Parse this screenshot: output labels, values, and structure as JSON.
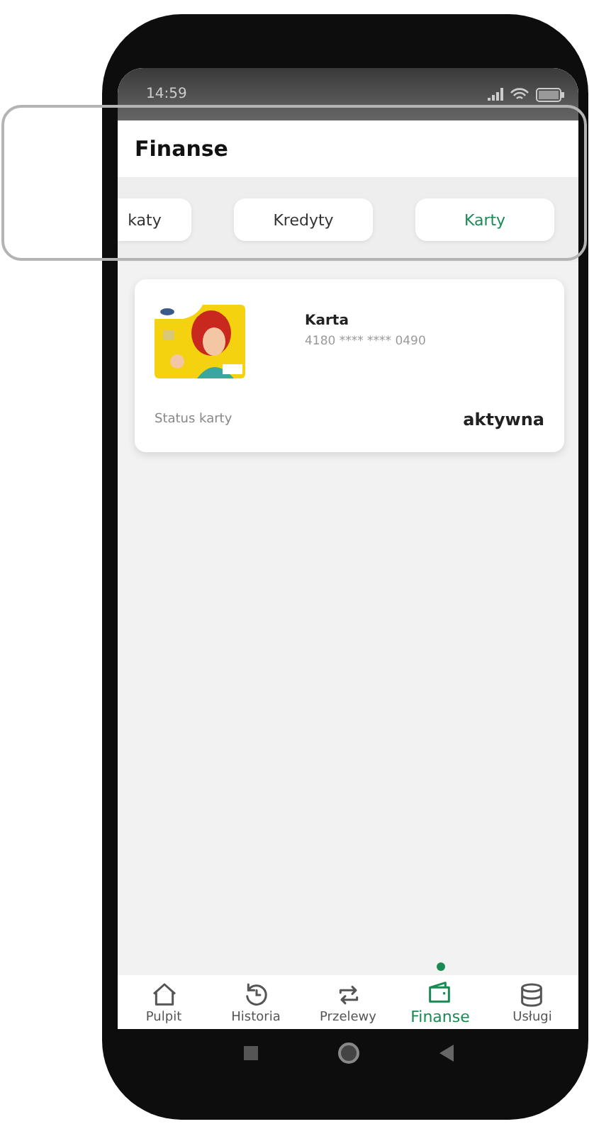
{
  "status_bar": {
    "time": "14:59"
  },
  "header": {
    "title": "Finanse"
  },
  "tabs": [
    {
      "label": "katy",
      "selected": false
    },
    {
      "label": "Kredyty",
      "selected": false
    },
    {
      "label": "Karty",
      "selected": true
    }
  ],
  "cards": [
    {
      "name": "Karta",
      "number": "4180 **** **** 0490",
      "status_label": "Status karty",
      "status": "aktywna"
    }
  ],
  "bottom_nav": [
    {
      "label": "Pulpit",
      "kind": "home",
      "selected": false
    },
    {
      "label": "Historia",
      "kind": "history",
      "selected": false
    },
    {
      "label": "Przelewy",
      "kind": "transfer",
      "selected": false
    },
    {
      "label": "Finanse",
      "kind": "wallet",
      "selected": true
    },
    {
      "label": "Usługi",
      "kind": "database",
      "selected": false
    }
  ]
}
